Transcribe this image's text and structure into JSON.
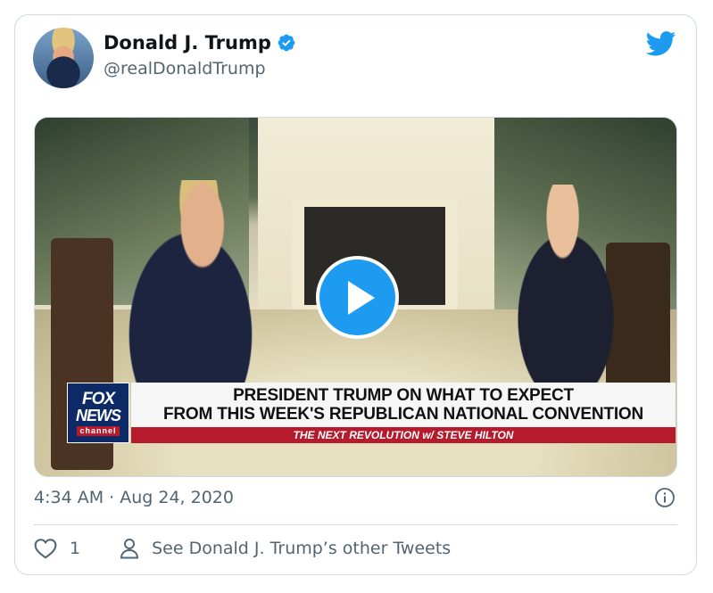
{
  "author": {
    "name": "Donald J. Trump",
    "handle": "@realDonaldTrump",
    "verified": true
  },
  "icons": {
    "bird": "twitter-bird-icon",
    "verified": "verified-badge-icon",
    "play": "play-icon",
    "info": "info-icon",
    "like": "heart-icon",
    "profile": "user-icon"
  },
  "colors": {
    "accent": "#1d9bf0",
    "text": "#0f1419",
    "muted": "#536471",
    "border": "#cfd9de",
    "fox_red": "#b51b2c",
    "fox_blue": "#0d2a66"
  },
  "media": {
    "lower_third": {
      "logo_line1": "FOX",
      "logo_line2": "NEWS",
      "logo_line3": "channel",
      "headline_line1": "PRESIDENT TRUMP ON WHAT TO EXPECT",
      "headline_line2": "FROM THIS WEEK'S REPUBLICAN NATIONAL CONVENTION",
      "show_label": "THE NEXT REVOLUTION w/ STEVE HILTON"
    }
  },
  "timestamp": "4:34 AM · Aug 24, 2020",
  "actions": {
    "like_count": "1",
    "profile_link": "See Donald J. Trump’s other Tweets"
  }
}
